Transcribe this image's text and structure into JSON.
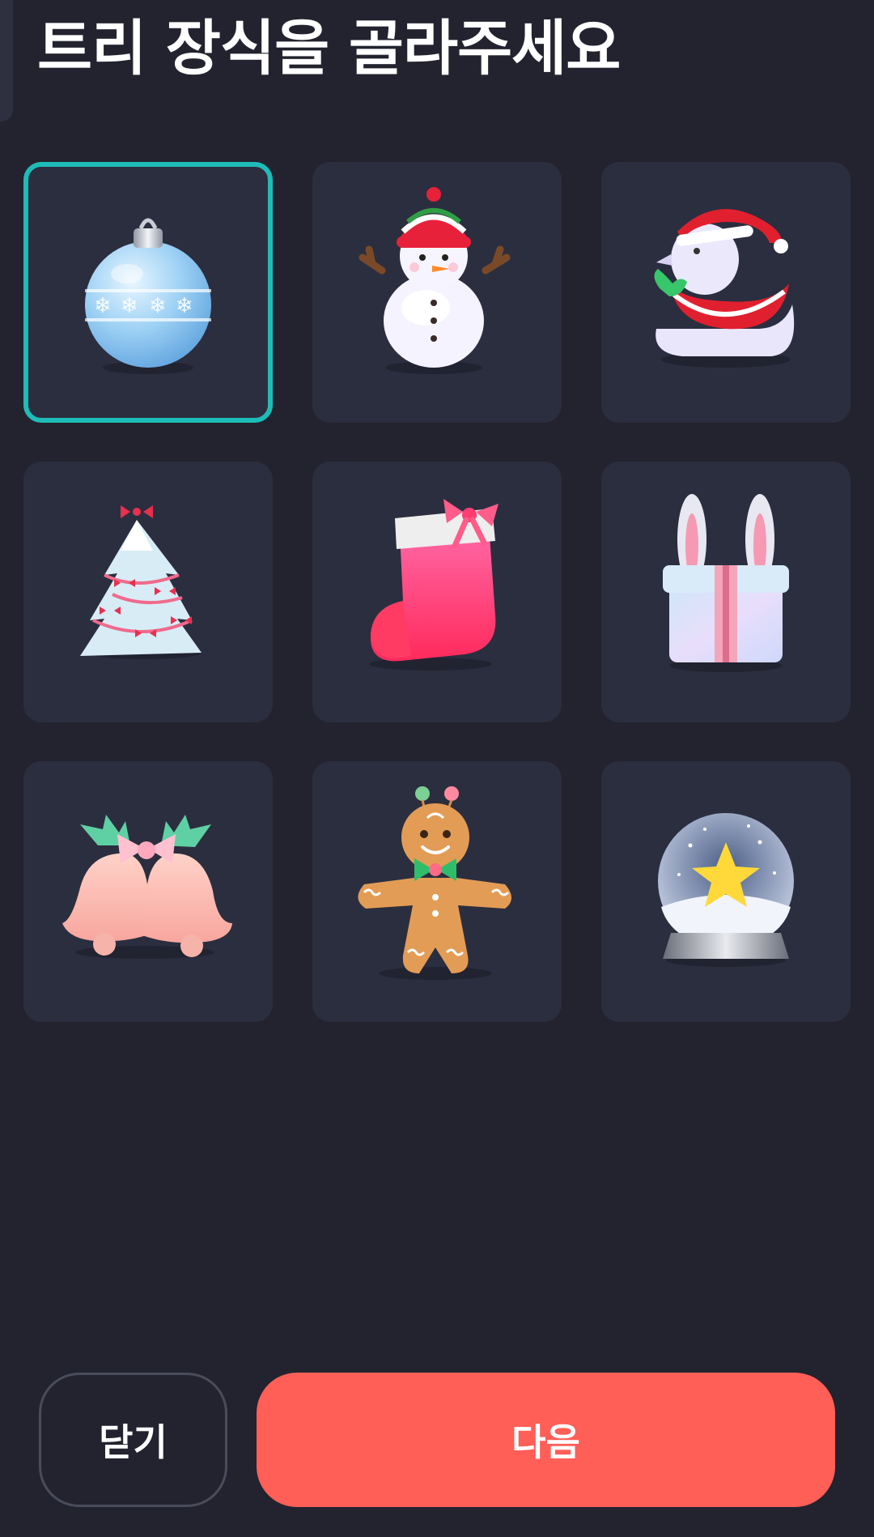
{
  "header": {
    "title": "트리 장식을 골라주세요"
  },
  "ornaments": {
    "selected_index": 0,
    "items": [
      {
        "icon": "blue-ornament-ball-icon"
      },
      {
        "icon": "snowman-icon"
      },
      {
        "icon": "santa-hat-duck-icon"
      },
      {
        "icon": "snowy-christmas-tree-icon"
      },
      {
        "icon": "christmas-stocking-icon"
      },
      {
        "icon": "bunny-ear-gift-box-icon"
      },
      {
        "icon": "christmas-bells-icon"
      },
      {
        "icon": "gingerbread-man-icon"
      },
      {
        "icon": "star-snow-globe-icon"
      }
    ]
  },
  "footer": {
    "close_label": "닫기",
    "next_label": "다음"
  },
  "colors": {
    "background": "#22232f",
    "tile": "#2b2e3f",
    "selection": "#1ebcb7",
    "primary_button": "#ff5f57"
  }
}
